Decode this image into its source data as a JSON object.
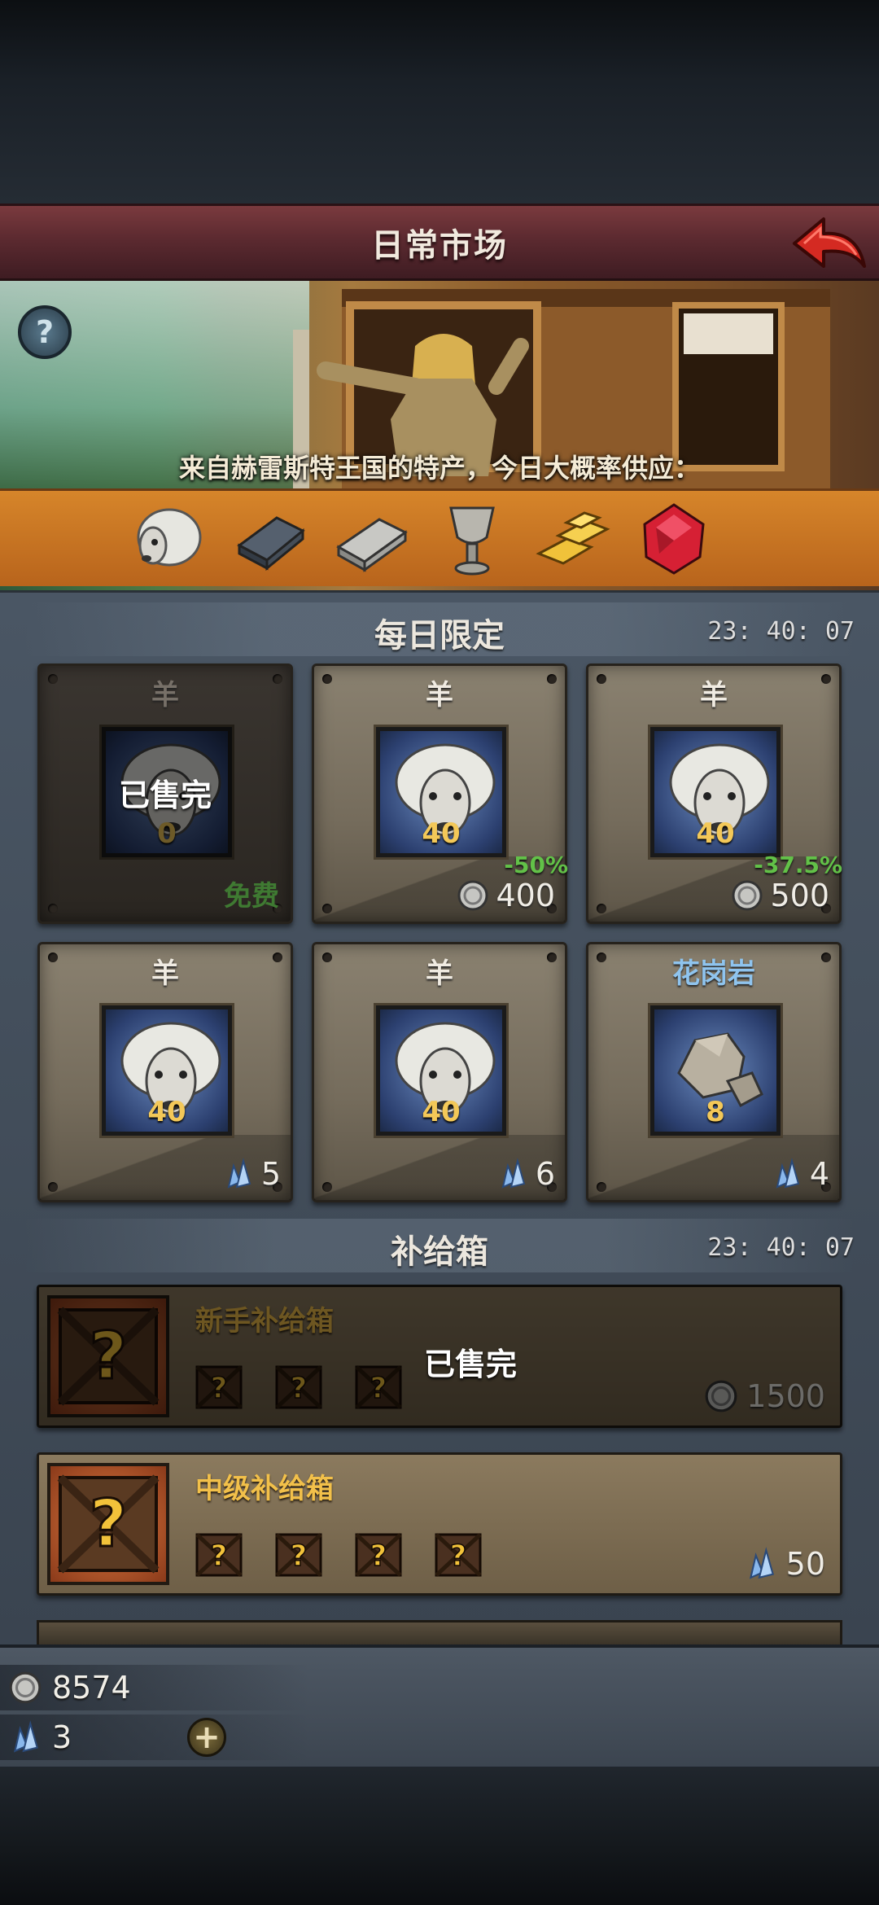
{
  "header": {
    "title": "日常市场"
  },
  "banner": {
    "caption": "来自赫雷斯特王国的特产，今日大概率供应：",
    "items": [
      "sheep-icon",
      "iron-ingot-icon",
      "silver-ingot-icon",
      "chalice-icon",
      "gold-bars-icon",
      "ruby-icon"
    ]
  },
  "daily": {
    "title": "每日限定",
    "timer": "23: 40: 07",
    "cards": [
      {
        "name": "羊",
        "qty": "0",
        "sold_label": "已售完",
        "free_label": "免费"
      },
      {
        "name": "羊",
        "qty": "40",
        "discount": "-50%",
        "price": "400",
        "currency": "silver"
      },
      {
        "name": "羊",
        "qty": "40",
        "discount": "-37.5%",
        "price": "500",
        "currency": "silver"
      },
      {
        "name": "羊",
        "qty": "40",
        "price": "5",
        "currency": "gem"
      },
      {
        "name": "羊",
        "qty": "40",
        "price": "6",
        "currency": "gem"
      },
      {
        "name": "花岗岩",
        "qty": "8",
        "price": "4",
        "currency": "gem"
      }
    ]
  },
  "supply": {
    "title": "补给箱",
    "timer": "23: 40: 07",
    "boxes": [
      {
        "title": "新手补给箱",
        "sold_label": "已售完",
        "price": "1500",
        "currency": "silver",
        "contents": 3
      },
      {
        "title": "中级补给箱",
        "price": "50",
        "currency": "gem",
        "contents": 4
      }
    ]
  },
  "wallet": {
    "silver": "8574",
    "gems": "3"
  }
}
